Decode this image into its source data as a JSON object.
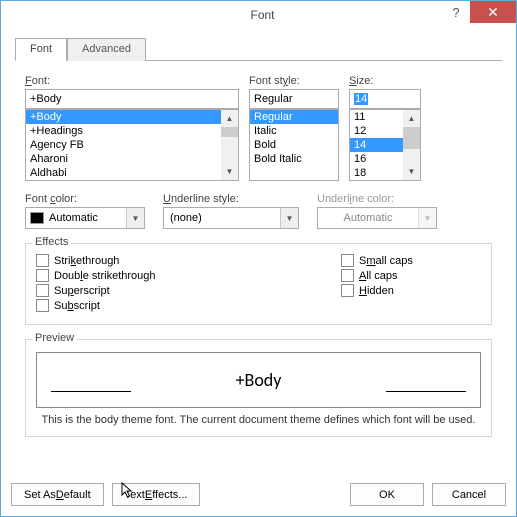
{
  "titlebar": {
    "title": "Font",
    "help": "?",
    "close": "✕"
  },
  "tabs": {
    "font": "Font",
    "advanced": "Advanced"
  },
  "labels": {
    "font": "Font:",
    "style": "Font style:",
    "size": "Size:",
    "fontColor": "Font color:",
    "underlineStyle": "Underline style:",
    "underlineColor": "Underline color:",
    "effects": "Effects",
    "preview": "Preview"
  },
  "font": {
    "value": "+Body",
    "list": [
      "+Body",
      "+Headings",
      "Agency FB",
      "Aharoni",
      "Aldhabi"
    ]
  },
  "style": {
    "value": "Regular",
    "list": [
      "Regular",
      "Italic",
      "Bold",
      "Bold Italic"
    ]
  },
  "size": {
    "value": "14",
    "list": [
      "11",
      "12",
      "14",
      "16",
      "18"
    ]
  },
  "fontColor": {
    "value": "Automatic"
  },
  "underlineStyle": {
    "value": "(none)"
  },
  "underlineColor": {
    "value": "Automatic"
  },
  "effects": {
    "strikethrough": "Strikethrough",
    "doubleStrikethrough": "Double strikethrough",
    "superscript": "Superscript",
    "subscript": "Subscript",
    "smallCaps": "Small caps",
    "allCaps": "All caps",
    "hidden": "Hidden"
  },
  "preview": {
    "sample": "+Body",
    "note": "This is the body theme font. The current document theme defines which font will be used."
  },
  "buttons": {
    "setDefault": "Set As Default",
    "textEffects": "Text Effects...",
    "ok": "OK",
    "cancel": "Cancel"
  }
}
